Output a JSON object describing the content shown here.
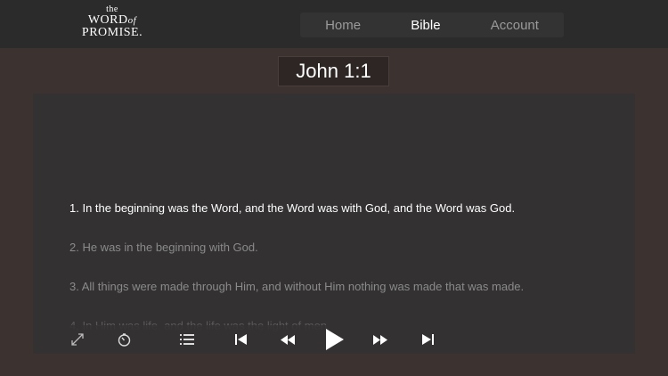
{
  "header": {
    "logo": {
      "line1": "the",
      "line2": "WORD",
      "line2b": "of",
      "line3": "PROMISE."
    },
    "nav": [
      {
        "label": "Home",
        "active": false
      },
      {
        "label": "Bible",
        "active": true
      },
      {
        "label": "Account",
        "active": false
      }
    ]
  },
  "reference": "John 1:1",
  "verses": [
    {
      "text": "1. In the beginning was the Word, and the Word was with God, and the Word was God.",
      "state": "active"
    },
    {
      "text": "2. He was in the beginning with God.",
      "state": "normal"
    },
    {
      "text": "3. All things were made through Him, and without Him nothing was made that was made.",
      "state": "normal"
    },
    {
      "text": "4. In Him was life, and the life was the light of men.",
      "state": "faded"
    }
  ],
  "controls": {
    "icons": [
      "expand-icon",
      "timer-icon",
      "list-icon",
      "skip-previous-icon",
      "rewind-icon",
      "play-icon",
      "fast-forward-icon",
      "skip-next-icon"
    ]
  },
  "colors": {
    "background": "#3c3330",
    "topbar": "#2b2b2b",
    "panel": "#333131",
    "active_text": "#ffffff",
    "inactive_text": "#8a8a8a"
  }
}
